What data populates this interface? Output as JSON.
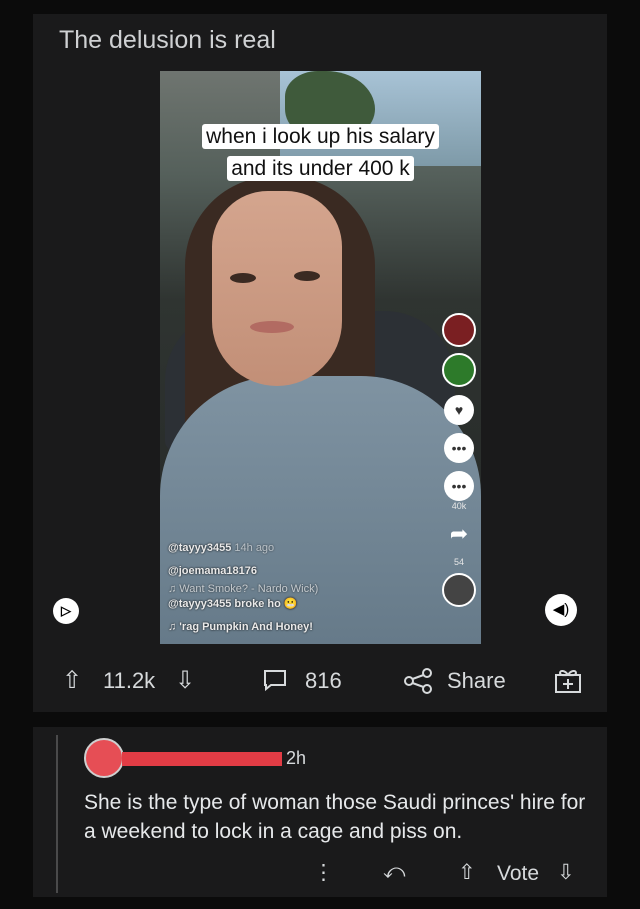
{
  "post": {
    "title": "The delusion is real",
    "video": {
      "caption_line1": "when i look up his salary",
      "caption_line2": "and its under 400 k",
      "handle": "@tayyy3455",
      "time_ago": "14h ago",
      "mention": "@joemama18176",
      "song_line": "♫  Want Smoke? - Nardo Wick)",
      "reply_line": "@tayyy3455 broke ho 😬",
      "sound_line": "♫  'rag   Pumpkin And Honey!",
      "share_count": "54",
      "likes_small": "40k"
    },
    "upvote_count": "11.2k",
    "comment_count": "816",
    "share_label": "Share"
  },
  "comment": {
    "time": "2h",
    "body": "She is the type of woman those Saudi princes' hire for a weekend to lock in a cage and piss on.",
    "vote_label": "Vote"
  },
  "colors": {
    "accent_red": "#e23c45",
    "background": "#0b0b0b",
    "card": "#1a1a1b"
  }
}
